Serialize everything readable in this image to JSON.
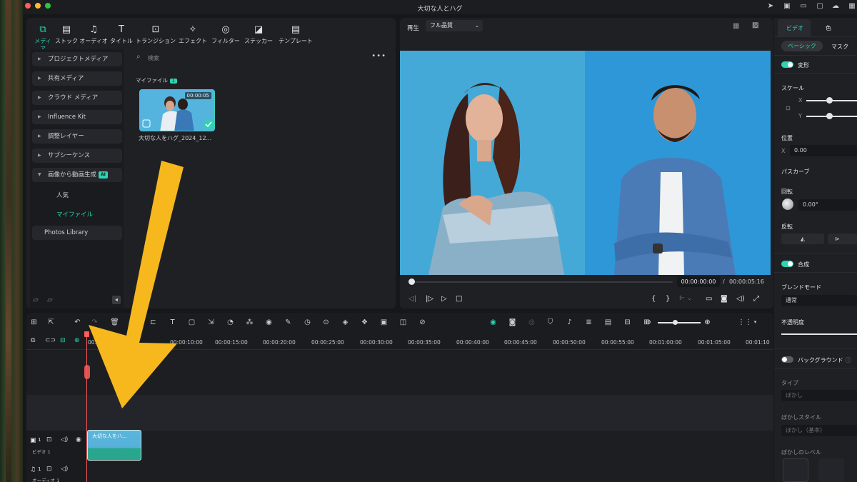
{
  "window": {
    "title": "大切な人とハグ"
  },
  "toolbar_tabs": [
    {
      "label": "メディア",
      "icon": "media-icon"
    },
    {
      "label": "ストック",
      "icon": "stock-icon"
    },
    {
      "label": "オーディオ",
      "icon": "music-note-icon"
    },
    {
      "label": "タイトル",
      "icon": "title-t-icon"
    },
    {
      "label": "トランジション",
      "icon": "transition-icon"
    },
    {
      "label": "エフェクト",
      "icon": "effect-sparkle-icon"
    },
    {
      "label": "フィルター",
      "icon": "filter-icon"
    },
    {
      "label": "ステッカー",
      "icon": "sticker-icon"
    },
    {
      "label": "テンプレート",
      "icon": "template-icon"
    }
  ],
  "sidebar": {
    "items": [
      {
        "label": "プロジェクトメディア"
      },
      {
        "label": "共有メディア"
      },
      {
        "label": "クラウド メディア"
      },
      {
        "label": "Influence Kit"
      },
      {
        "label": "調整レイヤー"
      },
      {
        "label": "サブシーケンス"
      },
      {
        "label": "画像から動画生成",
        "badge": "AI"
      }
    ],
    "sub_items": [
      {
        "label": "人気"
      },
      {
        "label": "マイファイル"
      }
    ],
    "photos_library": "Photos Library"
  },
  "media": {
    "search_placeholder": "検索",
    "section_label": "マイファイル",
    "section_count": "1",
    "clip": {
      "duration": "00:00:05",
      "name": "大切な人をハグ_2024_12..."
    }
  },
  "preview": {
    "play_label": "再生",
    "quality": "フル品質",
    "current_time": "00:00:00:00",
    "separator": "/",
    "total_time": "00:00:05:16"
  },
  "inspector": {
    "tab_video": "ビデオ",
    "tab_color": "色",
    "subtab_basic": "ベーシック",
    "subtab_mask": "マスク",
    "transform": "変形",
    "scale": "スケール",
    "scale_x": "X",
    "scale_y": "Y",
    "position": "位置",
    "position_x_label": "X",
    "position_x": "0.00",
    "path_curve": "パスカーブ",
    "rotation": "回転",
    "rotation_value": "0.00°",
    "flip": "反転",
    "composite": "合成",
    "blend_mode": "ブレンドモード",
    "blend_value": "通常",
    "opacity": "不透明度",
    "background": "バックグラウンド",
    "type_label": "タイプ",
    "type_value": "ぼかし",
    "blur_style_label": "ぼかしスタイル",
    "blur_style_value": "ぼかし（基本）",
    "blur_level_label": "ぼかしのレベル"
  },
  "timeline": {
    "ruler": [
      "00:00",
      "00:00:10:00",
      "00:00:15:00",
      "00:00:20:00",
      "00:00:25:00",
      "00:00:30:00",
      "00:00:35:00",
      "00:00:40:00",
      "00:00:45:00",
      "00:00:50:00",
      "00:00:55:00",
      "00:01:00:00",
      "00:01:05:00",
      "00:01:10"
    ],
    "video_track": {
      "index": "1",
      "name": "ビデオ 1"
    },
    "audio_track": {
      "index": "1",
      "name": "オーディオ 1"
    },
    "clip_label": "大切な人をハ..."
  },
  "colors": {
    "accent": "#2fd3b2",
    "arrow": "#f6b81c",
    "playhead": "#ff5b5b"
  }
}
